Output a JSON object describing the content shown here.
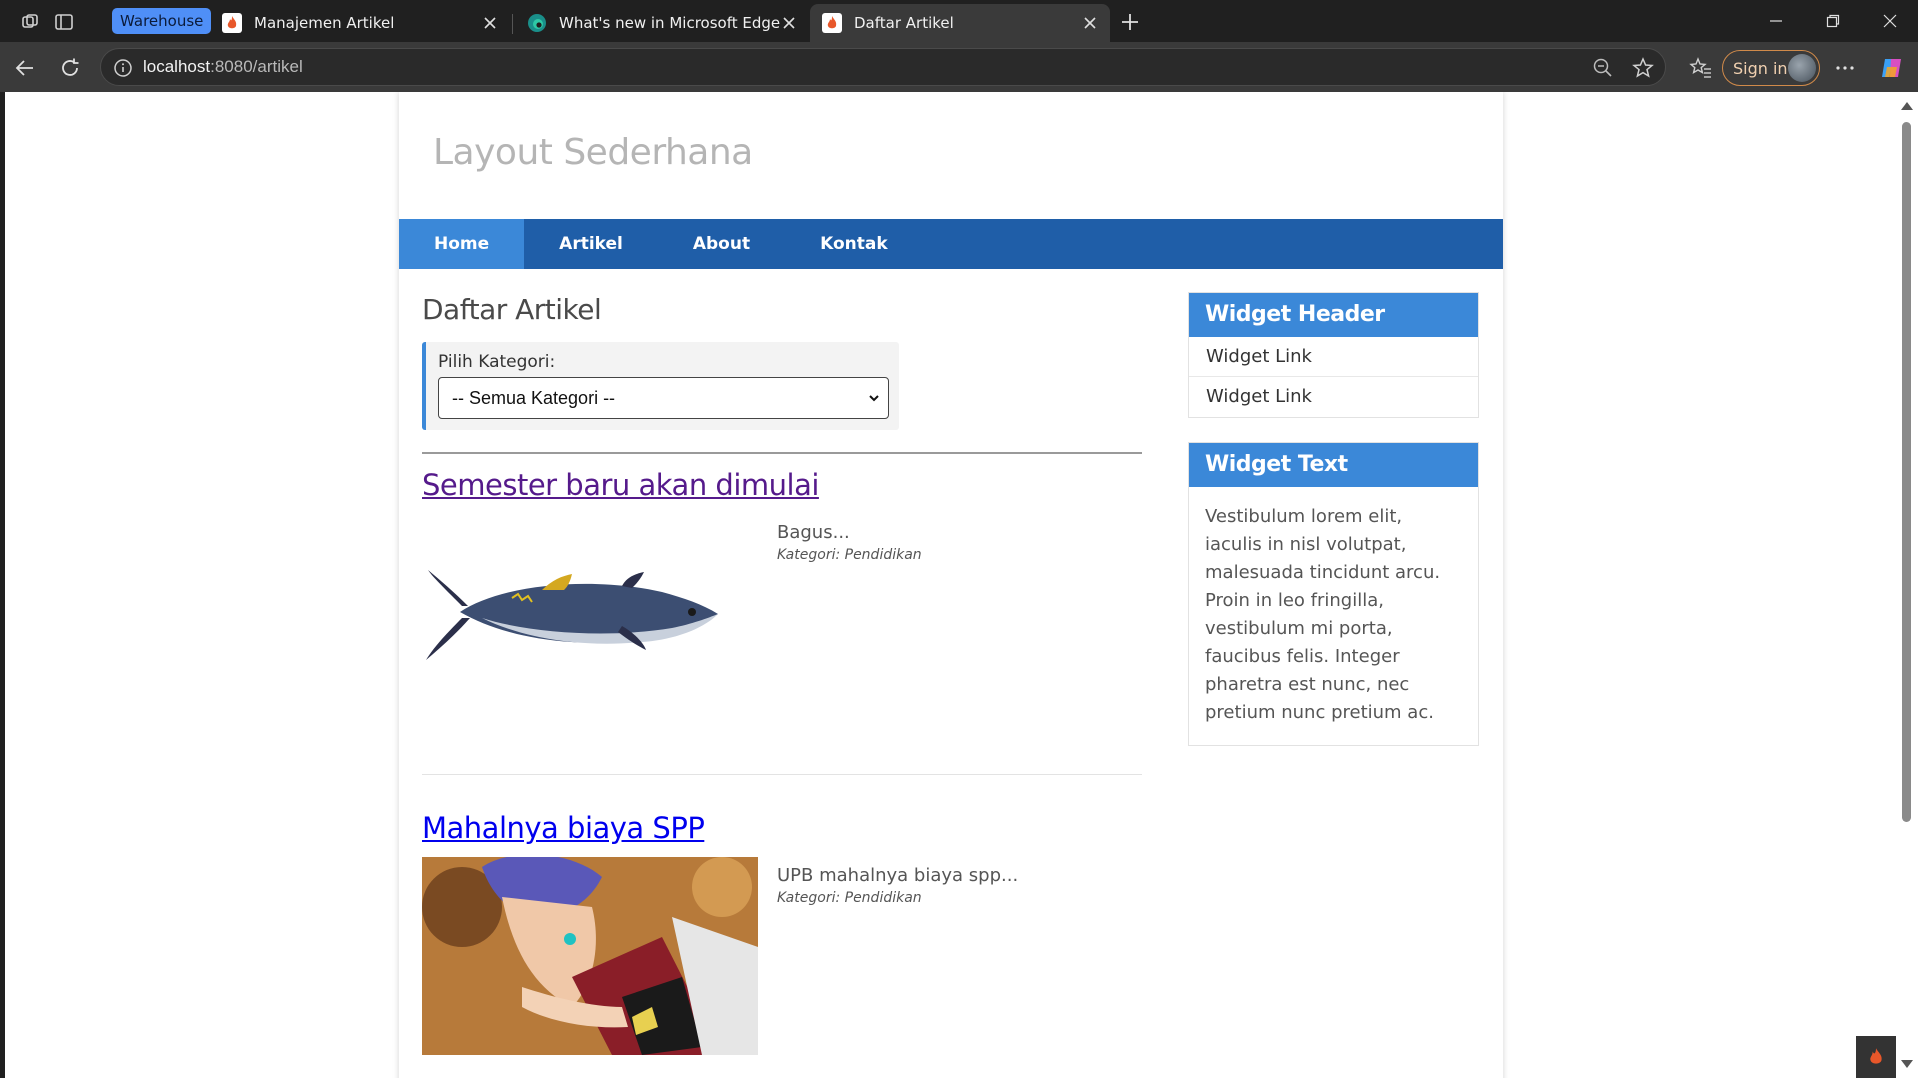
{
  "browser": {
    "tab_group_label": "Warehouse",
    "tabs": [
      {
        "title": "Manajemen Artikel",
        "favicon": "fire-icon"
      },
      {
        "title": "What's new in Microsoft Edge",
        "favicon": "edge-icon"
      },
      {
        "title": "Daftar Artikel",
        "favicon": "fire-icon",
        "active": true
      }
    ],
    "url_host": "localhost",
    "url_path": ":8080/artikel",
    "signin_label": "Sign in"
  },
  "site": {
    "title": "Layout Sederhana",
    "nav": [
      {
        "label": "Home",
        "active": true
      },
      {
        "label": "Artikel"
      },
      {
        "label": "About"
      },
      {
        "label": "Kontak"
      }
    ]
  },
  "main": {
    "heading": "Daftar Artikel",
    "filter": {
      "label": "Pilih Kategori:",
      "selected": "-- Semua Kategori --"
    },
    "articles": [
      {
        "title": "Semester baru akan dimulai",
        "excerpt": "Bagus...",
        "category": "Kategori: Pendidikan",
        "image": "tuna-fish",
        "visited": true
      },
      {
        "title": "Mahalnya biaya SPP",
        "excerpt": "UPB mahalnya biaya spp...",
        "category": "Kategori: Pendidikan",
        "image": "anime-character",
        "visited": false
      }
    ]
  },
  "sidebar": {
    "widget1": {
      "header": "Widget Header",
      "links": [
        "Widget Link",
        "Widget Link"
      ]
    },
    "widget2": {
      "header": "Widget Text",
      "text": "Vestibulum lorem elit, iaculis in nisl volutpat, malesuada tincidunt arcu. Proin in leo fringilla, vestibulum mi porta, faucibus felis. Integer pharetra est nunc, nec pretium nunc pretium ac."
    }
  },
  "colors": {
    "nav_bg": "#1f5ea8",
    "nav_active": "#3b88d8",
    "widget_head": "#3b88d8",
    "visited_link": "#551a8b",
    "link": "#0000ee"
  }
}
